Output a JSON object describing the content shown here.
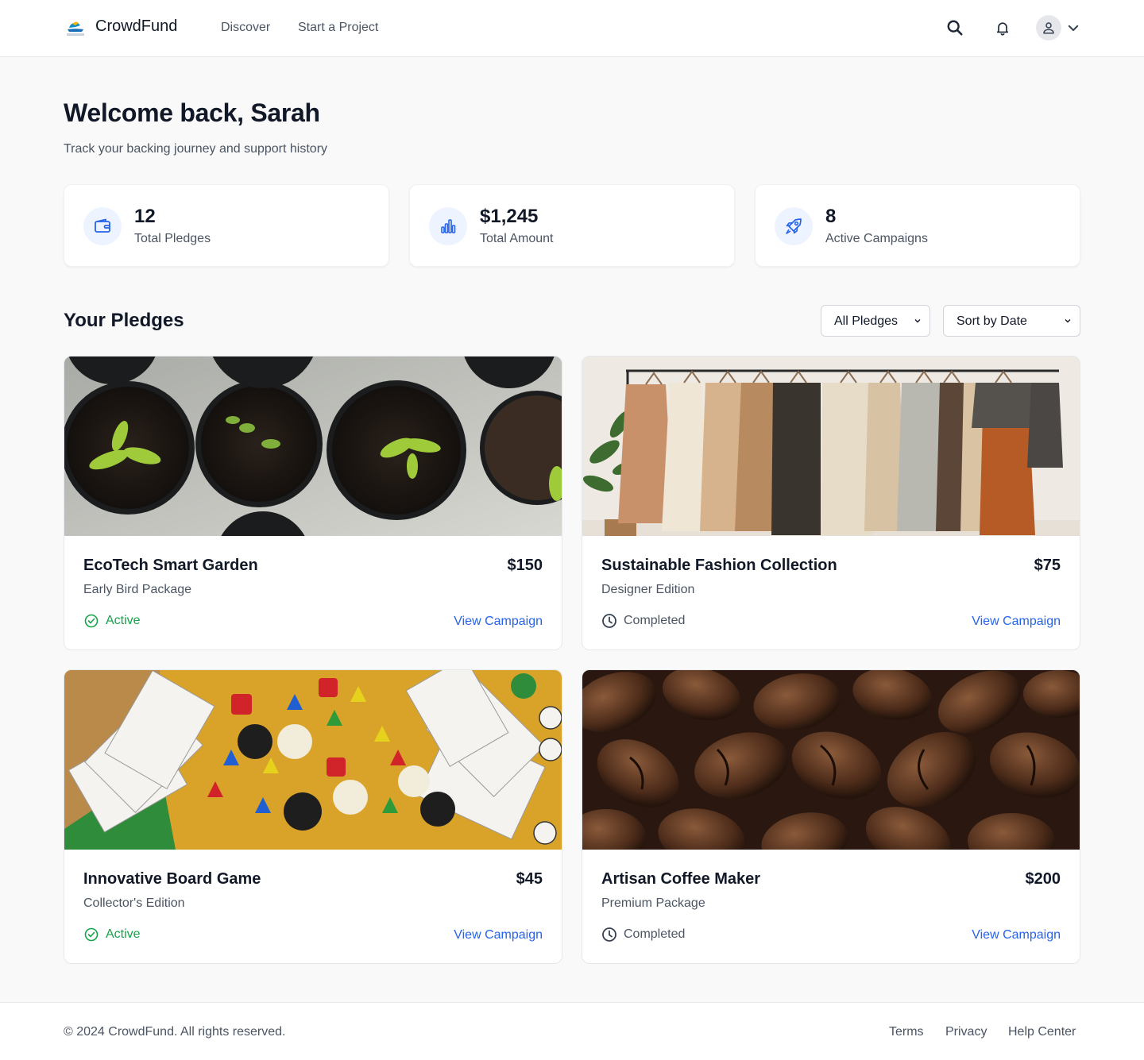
{
  "header": {
    "brand": "CrowdFund",
    "nav": {
      "discover": "Discover",
      "start_project": "Start a Project"
    },
    "icons": [
      "search-icon",
      "bell-icon",
      "user-icon",
      "chevron-down-icon"
    ]
  },
  "welcome": {
    "title": "Welcome back, Sarah",
    "subtitle": "Track your backing journey and support history"
  },
  "stats": [
    {
      "value": "12",
      "label": "Total Pledges",
      "icon": "wallet-icon"
    },
    {
      "value": "$1,245",
      "label": "Total Amount",
      "icon": "bar-chart-icon"
    },
    {
      "value": "8",
      "label": "Active Campaigns",
      "icon": "rocket-icon"
    }
  ],
  "pledges": {
    "title": "Your Pledges",
    "filter_selected": "All Pledges",
    "sort_selected": "Sort by Date",
    "items": [
      {
        "title": "EcoTech Smart Garden",
        "amount": "$150",
        "tier": "Early Bird Package",
        "status": "Active",
        "link": "View Campaign",
        "image": "seedlings-in-pots"
      },
      {
        "title": "Sustainable Fashion Collection",
        "amount": "$75",
        "tier": "Designer Edition",
        "status": "Completed",
        "link": "View Campaign",
        "image": "clothes-on-rack"
      },
      {
        "title": "Innovative Board Game",
        "amount": "$45",
        "tier": "Collector's Edition",
        "status": "Active",
        "link": "View Campaign",
        "image": "board-game-pieces"
      },
      {
        "title": "Artisan Coffee Maker",
        "amount": "$200",
        "tier": "Premium Package",
        "status": "Completed",
        "link": "View Campaign",
        "image": "coffee-beans"
      }
    ]
  },
  "footer": {
    "copyright": "© 2024 CrowdFund. All rights reserved.",
    "links": {
      "terms": "Terms",
      "privacy": "Privacy",
      "help": "Help Center"
    }
  },
  "colors": {
    "accent": "#2563eb",
    "active": "#16a34a",
    "background": "#f9f9f9",
    "text": "#111827",
    "muted": "#4b5563"
  }
}
